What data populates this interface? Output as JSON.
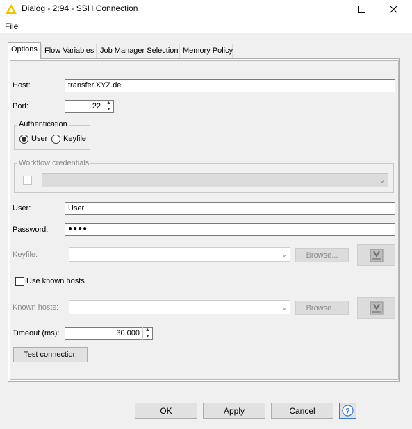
{
  "window": {
    "title": "Dialog - 2:94 - SSH Connection",
    "minimize_glyph": "—",
    "maximize_glyph": "☐",
    "close_glyph": "✕"
  },
  "menu": {
    "file": "File"
  },
  "tabs": [
    {
      "label": "Options",
      "active": true
    },
    {
      "label": "Flow Variables",
      "active": false
    },
    {
      "label": "Job Manager Selection",
      "active": false
    },
    {
      "label": "Memory Policy",
      "active": false
    }
  ],
  "form": {
    "host_label": "Host:",
    "host_value": "transfer.XYZ.de",
    "port_label": "Port:",
    "port_value": "22",
    "auth_group_title": "Authentication",
    "auth_user_label": "User",
    "auth_keyfile_label": "Keyfile",
    "auth_selected": "User",
    "workflow_credentials_title": "Workflow credentials",
    "user_label": "User:",
    "user_value": "User",
    "password_label": "Password:",
    "password_value": "●●●●",
    "keyfile_label": "Keyfile:",
    "keyfile_browse": "Browse...",
    "use_known_hosts_label": "Use known hosts",
    "known_hosts_label": "Known hosts:",
    "known_hosts_browse": "Browse...",
    "timeout_label": "Timeout (ms):",
    "timeout_value": "30.000",
    "test_connection_label": "Test connection"
  },
  "footer": {
    "ok": "OK",
    "apply": "Apply",
    "cancel": "Cancel",
    "help_glyph": "?"
  },
  "colors": {
    "app_icon": "#f5c400",
    "help_accent": "#3c7bc8"
  },
  "icons": {
    "app": "knime-triangle-icon",
    "flow_variable": "flow-variable-icon",
    "help": "help-icon"
  }
}
